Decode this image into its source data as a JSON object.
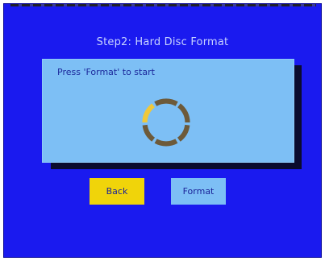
{
  "screen": {
    "title": "Step2: Hard Disc Format"
  },
  "panel": {
    "prompt": "Press 'Format' to start",
    "spinner_icon": "progress-ring-icon"
  },
  "buttons": {
    "back_label": "Back",
    "format_label": "Format"
  },
  "colors": {
    "background": "#1a1aef",
    "panel": "#7dbff5",
    "selected_button": "#f0d40a",
    "spinner_active": "#f0c83a",
    "spinner_inactive": "#6d5a3a"
  }
}
